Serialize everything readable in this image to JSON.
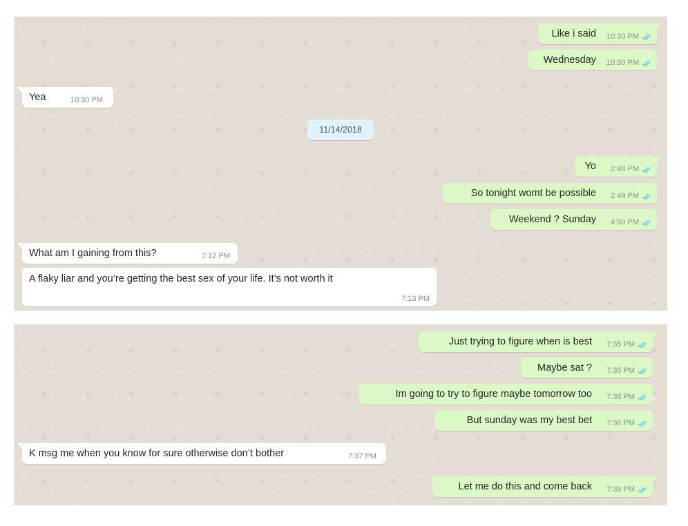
{
  "panel_top": {
    "msg1": {
      "text": "Like i said",
      "time": "10:30 PM"
    },
    "msg2": {
      "text": "Wednesday",
      "time": "10:30 PM"
    },
    "msg3": {
      "text": "Yea",
      "time": "10:30 PM"
    },
    "date": "11/14/2018",
    "msg4": {
      "text": "Yo",
      "time": "2:48 PM"
    },
    "msg5": {
      "text": "So tonight womt be possible",
      "time": "2:49 PM"
    },
    "msg6": {
      "text": "Weekend ? Sunday",
      "time": "4:50 PM"
    },
    "msg7": {
      "text": "What am I gaining from this?",
      "time": "7:12 PM"
    },
    "msg8": {
      "text": "A flaky liar and you’re getting the best sex of your life. It’s not worth it",
      "time": "7:13 PM"
    }
  },
  "panel_bottom": {
    "msg1": {
      "text": "Just trying to figure when is best",
      "time": "7:35 PM"
    },
    "msg2": {
      "text": "Maybe sat ?",
      "time": "7:35 PM"
    },
    "msg3": {
      "text": "Im going to try to figure maybe tomorrow too",
      "time": "7:36 PM"
    },
    "msg4": {
      "text": "But sunday was my best bet",
      "time": "7:36 PM"
    },
    "msg5": {
      "text": "K msg me when you know for sure otherwise don’t bother",
      "time": "7:37 PM"
    },
    "msg6": {
      "text": "Let me do this and come back",
      "time": "7:38 PM"
    }
  },
  "colors": {
    "outgoing": "#dcf8c6",
    "incoming": "#ffffff",
    "read_ticks": "#4fc3f7",
    "background": "#e4ddd4"
  },
  "icons": {
    "read_receipt": "double-check-icon"
  }
}
